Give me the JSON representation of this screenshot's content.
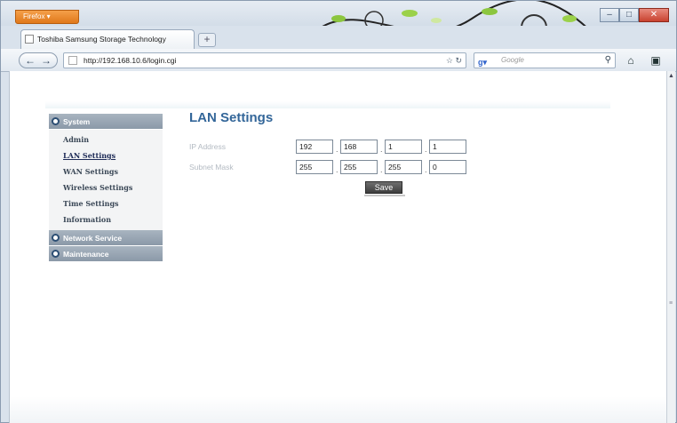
{
  "browser": {
    "app_button": "Firefox",
    "tab_title": "Toshiba Samsung Storage Technology",
    "new_tab": "+",
    "url": "http://192.168.10.6/login.cgi",
    "search_placeholder": "Google",
    "back_forward": "←→",
    "window_controls": {
      "minimize": "–",
      "maximize": "□",
      "close": "✕"
    }
  },
  "sidebar": {
    "sections": [
      {
        "label": "System",
        "items": [
          "Admin",
          "LAN Settings",
          "WAN Settings",
          "Wireless Settings",
          "Time Settings",
          "Information"
        ]
      },
      {
        "label": "Network Service",
        "items": []
      },
      {
        "label": "Maintenance",
        "items": []
      }
    ],
    "active_item": "LAN Settings"
  },
  "main": {
    "title": "LAN Settings",
    "ip_address": {
      "label": "IP Address",
      "octets": [
        "192",
        "168",
        "1",
        "1"
      ]
    },
    "subnet_mask": {
      "label": "Subnet Mask",
      "octets": [
        "255",
        "255",
        "255",
        "0"
      ]
    },
    "save_label": "Save"
  },
  "colors": {
    "title": "#336699",
    "sidebar_header": "#8b99a8",
    "save_button": "#4a4a4a"
  }
}
